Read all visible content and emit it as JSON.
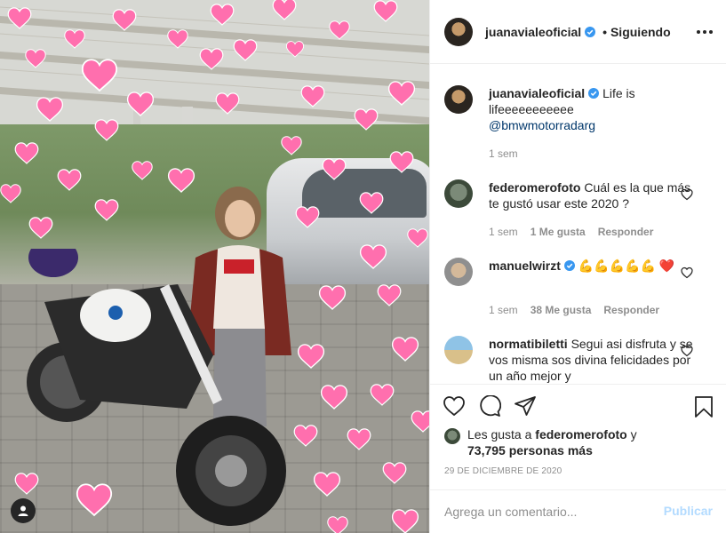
{
  "post_author": {
    "username": "juanavialeoficial",
    "separator": "•",
    "follow_status": "Siguiendo"
  },
  "caption": {
    "username": "juanavialeoficial",
    "text": "Life is lifeeeeeeeeeee",
    "mention": "@bmwmotorradarg",
    "time": "1 sem"
  },
  "comments": [
    {
      "username": "federomerofoto",
      "text": "Cuál es la que más te gustó usar este 2020 ?",
      "time": "1 sem",
      "likes": "1 Me gusta",
      "reply": "Responder"
    },
    {
      "username": "manuelwirzt",
      "text": "💪💪💪💪💪 ❤️",
      "time": "1 sem",
      "likes": "38 Me gusta",
      "reply": "Responder"
    },
    {
      "username": "normatibiletti",
      "text": "Segui asi disfruta y se vos misma sos divina felicidades por un año mejor y"
    }
  ],
  "likes_summary": {
    "prefix": "Les gusta a",
    "user": "federomerofoto",
    "conj": "y",
    "count_text": "73,795 personas más"
  },
  "post_date": "29 DE DICIEMBRE DE 2020",
  "comment_box": {
    "placeholder": "Agrega un comentario...",
    "publish_label": "Publicar"
  },
  "colors": {
    "verified": "#3897f0",
    "link": "#00376b",
    "muted": "#8e8e8e",
    "publish_disabled": "#b3dbff",
    "heart_pink": "#ff6fae"
  },
  "icons": [
    "more-options-icon",
    "verified-badge-icon",
    "like-icon",
    "comment-icon",
    "share-icon",
    "save-icon",
    "comment-like-icon",
    "tag-user-icon"
  ]
}
